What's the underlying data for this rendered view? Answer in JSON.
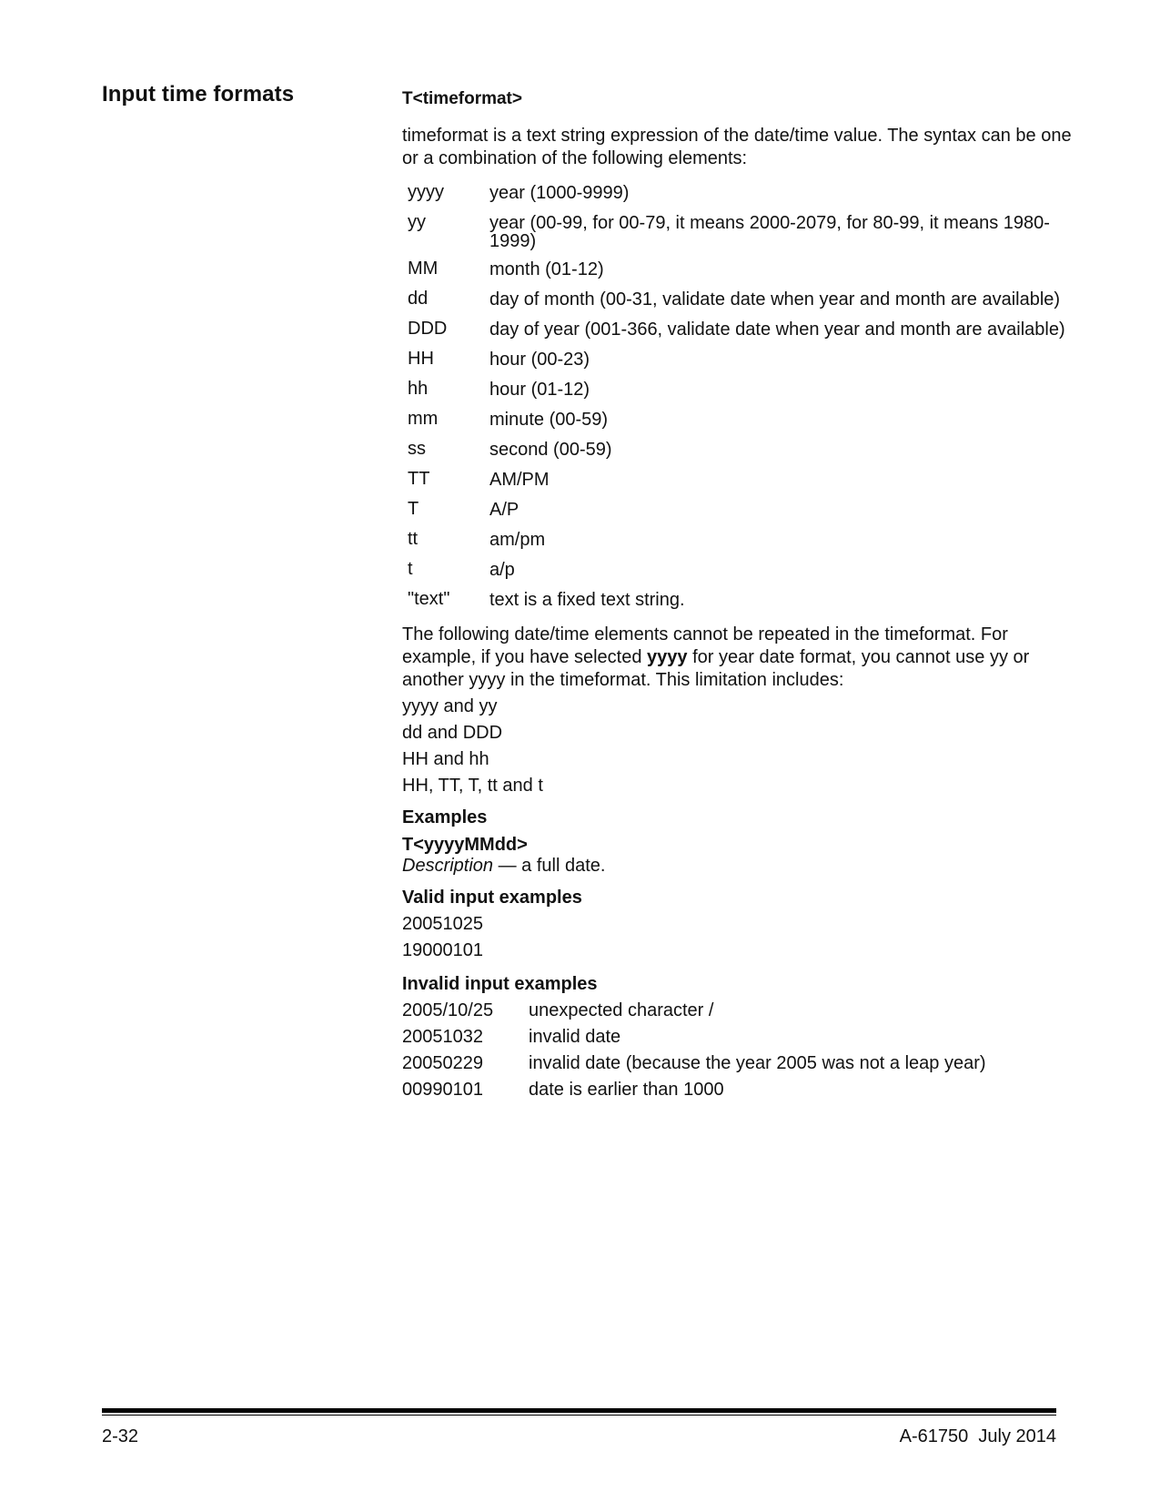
{
  "section": {
    "heading": "Input time formats"
  },
  "syntax": {
    "title": "T<timeformat>",
    "intro": "timeformat is a text string expression of the date/time value. The syntax can be one or a combination of the following elements:"
  },
  "elements": [
    {
      "code": "yyyy",
      "desc": "year (1000-9999)"
    },
    {
      "code": "yy",
      "desc": "year (00-99, for 00-79, it means 2000-2079, for 80-99, it means 1980-1999)"
    },
    {
      "code": "MM",
      "desc": "month (01-12)"
    },
    {
      "code": "dd",
      "desc": "day of month (00-31, validate date when year and month are available)"
    },
    {
      "code": "DDD",
      "desc": "day of year (001-366, validate date when year and month are available)"
    },
    {
      "code": "HH",
      "desc": "hour (00-23)"
    },
    {
      "code": "hh",
      "desc": "hour (01-12)"
    },
    {
      "code": "mm",
      "desc": "minute (00-59)"
    },
    {
      "code": "ss",
      "desc": "second (00-59)"
    },
    {
      "code": "TT",
      "desc": "AM/PM"
    },
    {
      "code": "T",
      "desc": "A/P"
    },
    {
      "code": "tt",
      "desc": "am/pm"
    },
    {
      "code": "t",
      "desc": "a/p"
    },
    {
      "code": "\"text\"",
      "desc": "text is a fixed text string."
    }
  ],
  "repeat_note": {
    "before": "The following date/time elements cannot be repeated in the timeformat. For example, if you have selected ",
    "bold": "yyyy",
    "after": " for year date format, you cannot use yy or another yyyy in the timeformat. This limitation includes:"
  },
  "limitations": [
    "yyyy and yy",
    "dd and DDD",
    "HH and hh",
    "HH, TT, T, tt and t"
  ],
  "examples": {
    "heading": "Examples",
    "format": "T<yyyyMMdd>",
    "description_label": "Description",
    "description_text": " — a full date.",
    "valid_heading": "Valid input examples",
    "valid": [
      "20051025",
      "19000101"
    ],
    "invalid_heading": "Invalid input examples",
    "invalid": [
      {
        "value": "2005/10/25",
        "reason": "unexpected character /"
      },
      {
        "value": "20051032",
        "reason": "invalid date"
      },
      {
        "value": "20050229",
        "reason": "invalid date (because the year 2005 was not a leap year)"
      },
      {
        "value": "00990101",
        "reason": "date is earlier than 1000"
      }
    ]
  },
  "footer": {
    "page": "2-32",
    "doc": "A-61750  July 2014"
  }
}
